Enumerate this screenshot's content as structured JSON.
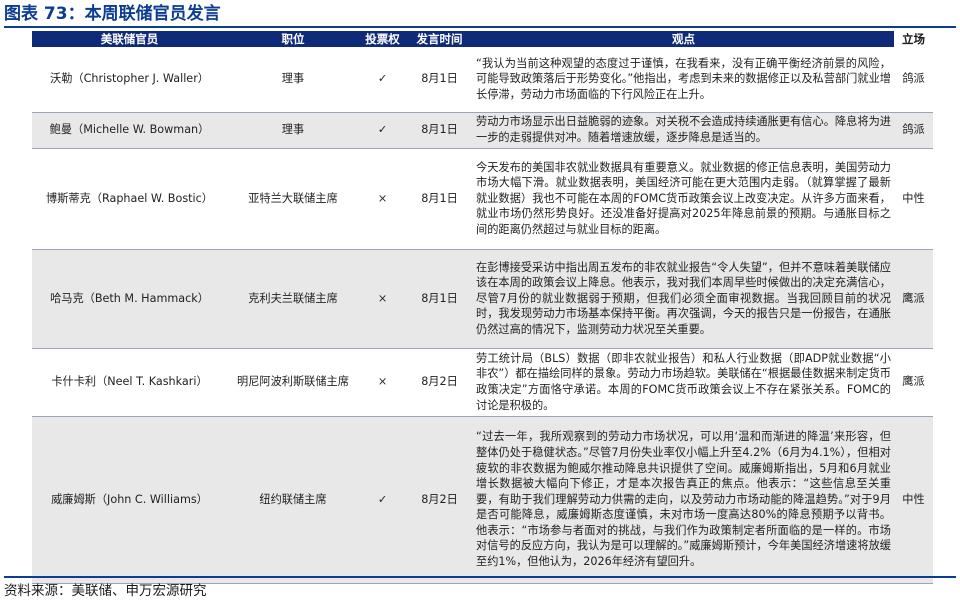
{
  "title": "图表 73：本周联储官员发言",
  "table": {
    "headers": [
      "美联储官员",
      "职位",
      "投票权",
      "发言时间",
      "观点",
      "立场"
    ],
    "rows": [
      {
        "official": "沃勒（Christopher J. Waller）",
        "position": "理事",
        "vote": "✓",
        "date": "8月1日",
        "opinion": "“我认为当前这种观望的态度过于谨慎，在我看来，没有正确平衡经济前景的风险，可能导致政策落后于形势变化。”他指出，考虑到未来的数据修正以及私营部门就业增长停滞，劳动力市场面临的下行风险正在上升。",
        "stance": "鸽派"
      },
      {
        "official": "鲍曼（Michelle W. Bowman）",
        "position": "理事",
        "vote": "✓",
        "date": "8月1日",
        "opinion": "劳动力市场显示出日益脆弱的迹象。对关税不会造成持续通胀更有信心。降息将为进一步的走弱提供对冲。随着增速放缓，逐步降息是适当的。",
        "stance": "鸽派"
      },
      {
        "official": "博斯蒂克（Raphael W. Bostic）",
        "position": "亚特兰大联储主席",
        "vote": "×",
        "date": "8月1日",
        "opinion": "今天发布的美国非农就业数据具有重要意义。就业数据的修正信息表明，美国劳动力市场大幅下滑。就业数据表明，美国经济可能在更大范围内走弱。（就算掌握了最新就业数据）我也不可能在本周的FOMC货币政策会议上改变决定。从许多方面来看，就业市场仍然形势良好。还没准备好提高对2025年降息前景的预期。与通胀目标之间的距离仍然超过与就业目标的距离。",
        "stance": "中性"
      },
      {
        "official": "哈马克（Beth M. Hammack）",
        "position": "克利夫兰联储主席",
        "vote": "×",
        "date": "8月1日",
        "opinion": "在彭博接受采访中指出周五发布的非农就业报告“令人失望”，但并不意味着美联储应该在本周的政策会议上降息。他表示，我对我们本周早些时候做出的决定充满信心，尽管7月份的就业数据弱于预期，但我们必须全面审视数据。当我回顾目前的状况时，我发现劳动力市场基本保持平衡。再次强调，今天的报告只是一份报告，在通胀仍然过高的情况下，监测劳动力状况至关重要。",
        "stance": "鹰派"
      },
      {
        "official": "卡什卡利（Neel T. Kashkari）",
        "position": "明尼阿波利斯联储主席",
        "vote": "×",
        "date": "8月2日",
        "opinion": "劳工统计局（BLS）数据（即非农就业报告）和私人行业数据（即ADP就业数据“小非农”）都在描绘同样的景象。劳动力市场趋软。美联储在“根据最佳数据来制定货币政策决定”方面恪守承诺。本周的FOMC货币政策会议上不存在紧张关系。FOMC的讨论是积极的。",
        "stance": "鹰派"
      },
      {
        "official": "威廉姆斯（John C. Williams）",
        "position": "纽约联储主席",
        "vote": "✓",
        "date": "8月2日",
        "opinion": "“过去一年，我所观察到的劳动力市场状况，可以用‘温和而渐进的降温’来形容，但整体仍处于稳健状态。”尽管7月份失业率仅小幅上升至4.2%（6月为4.1%），但相对疲软的非农数据为鲍威尔推动降息共识提供了空间。威廉姆斯指出，5月和6月就业增长数据被大幅向下修正，才是本次报告真正的焦点。他表示：“这些信息至关重要，有助于我们理解劳动力供需的走向，以及劳动力市场动能的降温趋势。”对于9月是否可能降息，威廉姆斯态度谨慎，未对市场一度高达80%的降息预期予以背书。他表示：“市场参与者面对的挑战，与我们作为政策制定者所面临的是一样的。市场对信号的反应方向，我认为是可以理解的。”威廉姆斯预计，今年美国经济增速将放缓至约1%，但他认为，2026年经济有望回升。",
        "stance": "中性"
      }
    ]
  },
  "footer": "资料来源：美联储、申万宏源研究"
}
